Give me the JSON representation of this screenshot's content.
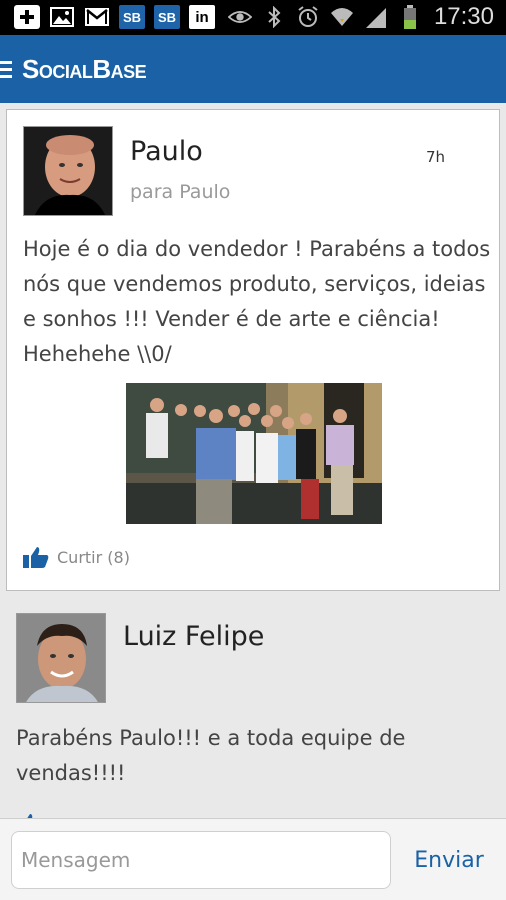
{
  "status_bar": {
    "time": "17:30",
    "left_icons": [
      "add-icon",
      "image-icon",
      "gmail-icon",
      "socialbase-icon",
      "socialbase-icon",
      "linkedin-icon"
    ],
    "sb_label": "SB",
    "in_label": "in",
    "right_icons": [
      "eye-icon",
      "bluetooth-icon",
      "alarm-icon",
      "wifi-icon",
      "signal-icon",
      "battery-icon"
    ]
  },
  "app_bar": {
    "title": "SocialBase",
    "brand_color": "#1a62a5"
  },
  "posts": [
    {
      "author": "Paulo",
      "recipient": "para Paulo",
      "time": "7h",
      "text": "Hoje é o dia do vendedor ! Parabéns a todos nós que vendemos produto, serviços, ideias e sonhos !!! Vender é de arte e ciência! Hehehehe \\\\0/",
      "like_label": "Curtir (8)"
    }
  ],
  "comments": [
    {
      "author": "Luiz Felipe",
      "text": "Parabéns Paulo!!! e a toda equipe de vendas!!!!"
    }
  ],
  "composer": {
    "placeholder": "Mensagem",
    "send_label": "Enviar"
  }
}
